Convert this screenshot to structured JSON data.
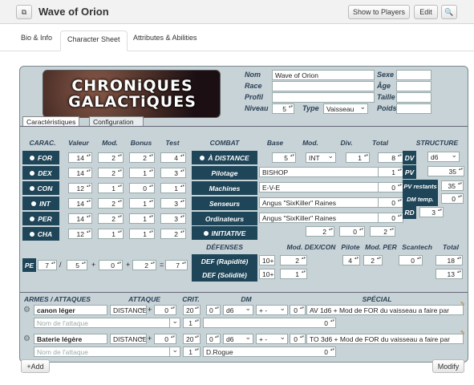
{
  "window": {
    "title": "Wave of Orion",
    "show_players": "Show to Players",
    "edit": "Edit",
    "search_icon": "🔍",
    "menu_icon": "⧉"
  },
  "tabs": [
    "Bio & Info",
    "Character Sheet",
    "Attributes & Abilities"
  ],
  "logo": {
    "line1": "CHRONiQUES",
    "line2": "GALACTiQUES"
  },
  "identity": {
    "nom_label": "Nom",
    "nom": "Wave of Orion",
    "race_label": "Race",
    "profil_label": "Profil",
    "niveau_label": "Niveau",
    "niveau": "5",
    "type_label": "Type",
    "type": "Vaisseau",
    "sexe_label": "Sexe",
    "age_label": "Âge",
    "taille_label": "Taille",
    "poids_label": "Poids"
  },
  "subtabs": [
    "Caractéristiques",
    "Configuration"
  ],
  "carac": {
    "headers": [
      "CARAC.",
      "Valeur",
      "Mod.",
      "Bonus",
      "Test"
    ],
    "rows": [
      {
        "name": "FOR",
        "valeur": "14",
        "mod": "2",
        "bonus": "2",
        "test": "4"
      },
      {
        "name": "DEX",
        "valeur": "14",
        "mod": "2",
        "bonus": "1",
        "test": "3"
      },
      {
        "name": "CON",
        "valeur": "12",
        "mod": "1",
        "bonus": "0",
        "test": "1"
      },
      {
        "name": "INT",
        "valeur": "14",
        "mod": "2",
        "bonus": "1",
        "test": "3"
      },
      {
        "name": "PER",
        "valeur": "14",
        "mod": "2",
        "bonus": "1",
        "test": "3"
      },
      {
        "name": "CHA",
        "valeur": "12",
        "mod": "1",
        "bonus": "1",
        "test": "2"
      }
    ]
  },
  "pe": {
    "label": "PE",
    "a": "7",
    "b": "5",
    "c": "0",
    "d": "2",
    "total": "7",
    "slash": "/",
    "plus": "+",
    "eq": "="
  },
  "combat": {
    "headers": [
      "COMBAT",
      "Base",
      "Mod.",
      "Div.",
      "Total"
    ],
    "distance_label": "À DISTANCE",
    "distance_base": "5",
    "distance_mod": "INT",
    "distance_div": "1",
    "distance_total": "8",
    "rows": [
      {
        "label": "Pilotage",
        "value": "BISHOP",
        "num": "1"
      },
      {
        "label": "Machines",
        "value": "E-V-E",
        "num": "0"
      },
      {
        "label": "Senseurs",
        "value": "Angus \"SixKiller\" Raines",
        "num": "0"
      },
      {
        "label": "Ordinateurs",
        "value": "Angus \"SixKiller\" Raines",
        "num": "0"
      }
    ],
    "initiative_label": "INITIATIVE",
    "init_a": "2",
    "init_b": "0",
    "init_c": "2"
  },
  "structure": {
    "header": "STRUCTURE",
    "dv_label": "DV",
    "dv": "d6",
    "pv_label": "PV",
    "pv": "35",
    "pv_restants_label": "PV restants",
    "pv_restants": "35",
    "dm_temp_label": "DM temp.",
    "dm_temp": "0",
    "rd_label": "RD",
    "rd": "3"
  },
  "defenses": {
    "header": "DÉFENSES",
    "col_dexcon": "Mod. DEX/CON",
    "col_pilote": "Pilote",
    "col_modper": "Mod. PER",
    "col_scantech": "Scantech",
    "col_total": "Total",
    "rap_label": "DEF (Rapidité)",
    "rap_base": "10+",
    "rap_dexcon": "2",
    "rap_pilote": "4",
    "rap_modper": "2",
    "rap_scantech": "0",
    "rap_total": "18",
    "sol_label": "DEF (Solidité)",
    "sol_base": "10+",
    "sol_dexcon": "1",
    "sol_total": "13"
  },
  "attacks": {
    "headers": [
      "ARMES / ATTAQUES",
      "ATTAQUE",
      "CRIT.",
      "DM",
      "SPÉCIAL"
    ],
    "placeholder": "Nom de l'attaque",
    "rows": [
      {
        "name": "canon léger",
        "type": "DISTANCE",
        "plus1": "+",
        "n1": "0",
        "crit": "20",
        "dm_n": "0",
        "dice": "d6",
        "plus2": "+ -",
        "n2": "0",
        "special": "AV 1d6 + Mod de FOR du vaisseau a faire par",
        "n3": "1",
        "sub_num": "0",
        "sub_text": ""
      },
      {
        "name": "Baterie légère",
        "type": "DISTANCE",
        "plus1": "+",
        "n1": "0",
        "crit": "20",
        "dm_n": "0",
        "dice": "d6",
        "plus2": "+ -",
        "n2": "0",
        "special": "TO 3d6 + Mod de FOR du vaisseau  a faire par",
        "n3": "1",
        "sub_num": "0",
        "sub_text": "D.Rogue"
      }
    ]
  },
  "footer": {
    "add": "+Add",
    "modify": "Modify"
  }
}
